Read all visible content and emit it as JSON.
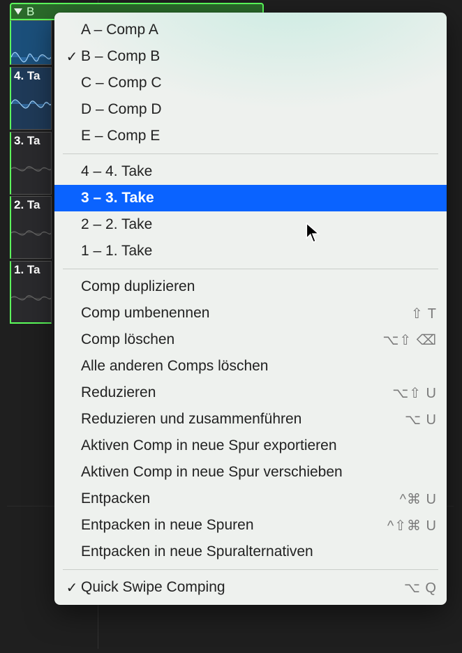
{
  "folder": {
    "label": "B"
  },
  "takes_panel": {
    "lanes": [
      {
        "label": "4. Ta",
        "active": true
      },
      {
        "label": "3. Ta",
        "active": false
      },
      {
        "label": "2. Ta",
        "active": false
      },
      {
        "label": "1. Ta",
        "active": false
      }
    ]
  },
  "menu": {
    "comps": [
      {
        "label": "A – Comp A",
        "checked": false
      },
      {
        "label": "B – Comp B",
        "checked": true
      },
      {
        "label": "C – Comp C",
        "checked": false
      },
      {
        "label": "D – Comp D",
        "checked": false
      },
      {
        "label": "E – Comp E",
        "checked": false
      }
    ],
    "takes": [
      {
        "label": "4 – 4. Take",
        "highlighted": false
      },
      {
        "label": "3 – 3. Take",
        "highlighted": true
      },
      {
        "label": "2 – 2. Take",
        "highlighted": false
      },
      {
        "label": "1 – 1. Take",
        "highlighted": false
      }
    ],
    "actions": [
      {
        "label": "Comp duplizieren",
        "shortcut": ""
      },
      {
        "label": "Comp umbenennen",
        "shortcut": "⇧ T"
      },
      {
        "label": "Comp löschen",
        "shortcut": "⌥⇧ ⌫"
      },
      {
        "label": "Alle anderen Comps löschen",
        "shortcut": ""
      },
      {
        "label": "Reduzieren",
        "shortcut": "⌥⇧ U"
      },
      {
        "label": "Reduzieren und zusammenführen",
        "shortcut": "⌥ U"
      },
      {
        "label": "Aktiven Comp in neue Spur exportieren",
        "shortcut": ""
      },
      {
        "label": "Aktiven Comp in neue Spur verschieben",
        "shortcut": ""
      },
      {
        "label": "Entpacken",
        "shortcut": "^⌘ U"
      },
      {
        "label": "Entpacken in neue Spuren",
        "shortcut": "^⇧⌘ U"
      },
      {
        "label": "Entpacken in neue Spuralternativen",
        "shortcut": ""
      }
    ],
    "footer": {
      "label": "Quick Swipe Comping",
      "checked": true,
      "shortcut": "⌥ Q"
    }
  }
}
